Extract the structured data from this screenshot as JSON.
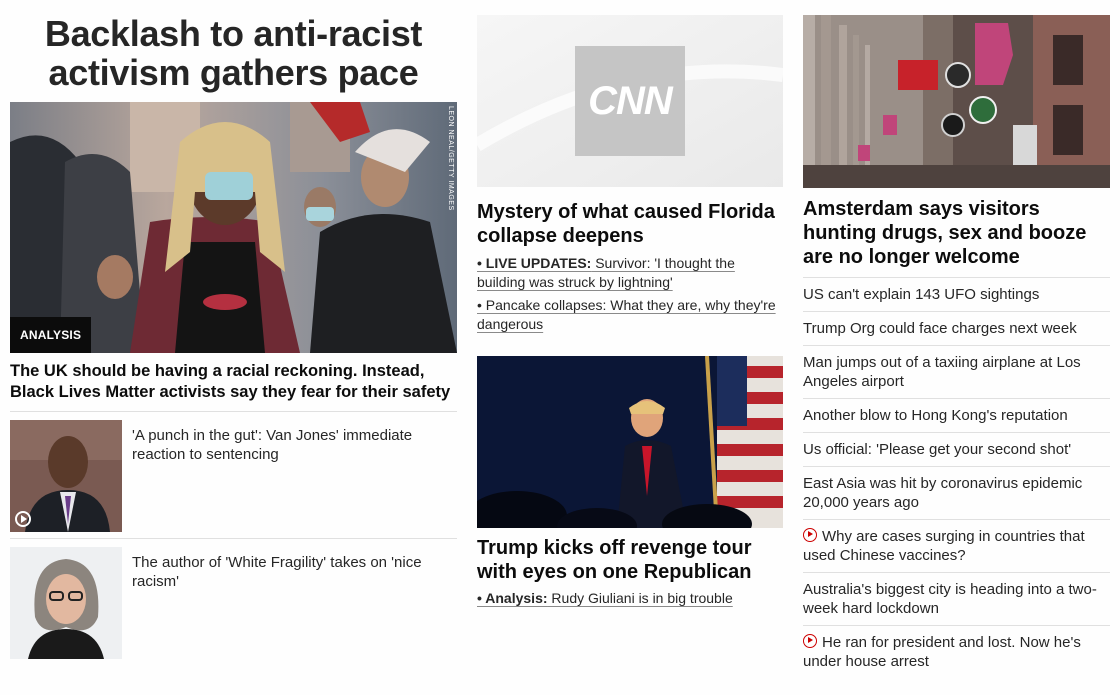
{
  "col1": {
    "headline": "Backlash to anti-racist activism gathers pace",
    "hero_badge": "ANALYSIS",
    "hero_credit": "LEON NEAL/GETTY IMAGES",
    "hero_title": "The UK should be having a racial reckoning. Instead, Black Lives Matter activists say they fear for their safety",
    "stories": [
      {
        "text": "'A punch in the gut': Van Jones' immediate reaction to sentencing"
      },
      {
        "text": "The author of 'White Fragility' takes on 'nice racism'"
      }
    ]
  },
  "col2": {
    "card1": {
      "logo": "CNN",
      "title": "Mystery of what caused Florida collapse deepens",
      "sub1_prefix": "• LIVE UPDATES:",
      "sub1_text": " Survivor: 'I thought the building was struck by lightning'",
      "sub2_text": "• Pancake collapses: What they are, why they're dangerous"
    },
    "card2": {
      "title": "Trump kicks off revenge tour with eyes on one Republican",
      "sub_prefix": "• Analysis:",
      "sub_text": " Rudy Giuliani is in big trouble"
    }
  },
  "col3": {
    "title": "Amsterdam says visitors hunting drugs, sex and booze are no longer welcome",
    "items": [
      {
        "text": "US can't explain 143 UFO sightings",
        "video": false
      },
      {
        "text": "Trump Org could face charges next week",
        "video": false
      },
      {
        "text": "Man jumps out of a taxiing airplane at Los Angeles airport",
        "video": false
      },
      {
        "text": "Another blow to Hong Kong's reputation",
        "video": false
      },
      {
        "text": "Us official: 'Please get your second shot'",
        "video": false
      },
      {
        "text": "East Asia was hit by coronavirus epidemic 20,000 years ago",
        "video": false
      },
      {
        "text": "Why are cases surging in countries that used Chinese vaccines?",
        "video": true
      },
      {
        "text": "Australia's biggest city is heading into a two-week hard lockdown",
        "video": false
      },
      {
        "text": "He ran for president and lost. Now he's under house arrest",
        "video": true
      }
    ]
  },
  "colors": {
    "accent_red": "#cc0000",
    "text": "#0c0c0c"
  }
}
